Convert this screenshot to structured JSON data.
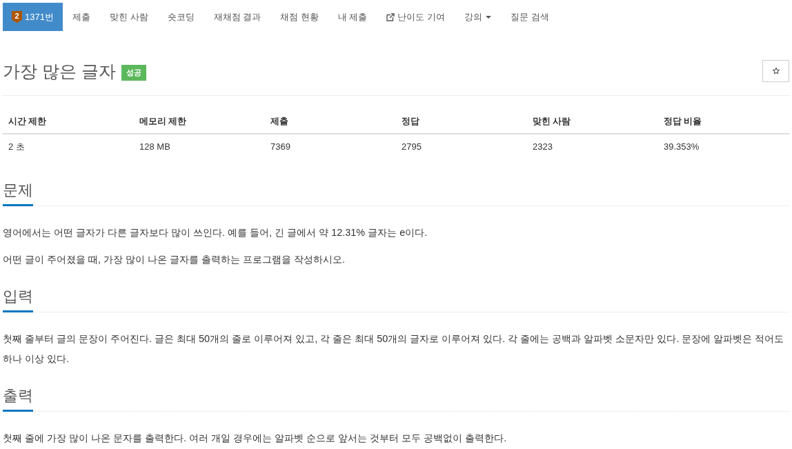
{
  "nav": {
    "items": [
      {
        "kind": "problem",
        "tier": "2",
        "label": "1371번",
        "selected": true
      },
      {
        "kind": "link",
        "label": "제출",
        "selected": false
      },
      {
        "kind": "link",
        "label": "맞힌 사람",
        "selected": false
      },
      {
        "kind": "link",
        "label": "숏코딩",
        "selected": false
      },
      {
        "kind": "link",
        "label": "재채점 결과",
        "selected": false
      },
      {
        "kind": "link",
        "label": "채점 현황",
        "selected": false
      },
      {
        "kind": "link",
        "label": "내 제출",
        "selected": false
      },
      {
        "kind": "external",
        "label": "난이도 기여",
        "selected": false
      },
      {
        "kind": "dropdown",
        "label": "강의",
        "selected": false
      },
      {
        "kind": "link",
        "label": "질문 검색",
        "selected": false
      }
    ]
  },
  "problem": {
    "title": "가장 많은 글자",
    "result": {
      "label": "성공",
      "kind": "success"
    },
    "starred": false
  },
  "info_table": {
    "columns": [
      "시간 제한",
      "메모리 제한",
      "제출",
      "정답",
      "맞힌 사람",
      "정답 비율"
    ],
    "rows": [
      [
        "2 초",
        "128 MB",
        "7369",
        "2795",
        "2323",
        "39.353%"
      ]
    ]
  },
  "sections": [
    {
      "heading": "문제",
      "paragraphs": [
        "영어에서는 어떤 글자가 다른 글자보다 많이 쓰인다. 예를 들어, 긴 글에서 약 12.31% 글자는 e이다.",
        "어떤 글이 주어졌을 때, 가장 많이 나온 글자를 출력하는 프로그램을 작성하시오."
      ]
    },
    {
      "heading": "입력",
      "paragraphs": [
        "첫째 줄부터 글의 문장이 주어진다. 글은 최대 50개의 줄로 이루어져 있고, 각 줄은 최대 50개의 글자로 이루어져 있다. 각 줄에는 공백과 알파벳 소문자만 있다. 문장에 알파벳은 적어도 하나 이상 있다."
      ]
    },
    {
      "heading": "출력",
      "paragraphs": [
        "첫째 줄에 가장 많이 나온 문자를 출력한다. 여러 개일 경우에는 알파벳 순으로 앞서는 것부터 모두 공백없이 출력한다."
      ]
    }
  ]
}
